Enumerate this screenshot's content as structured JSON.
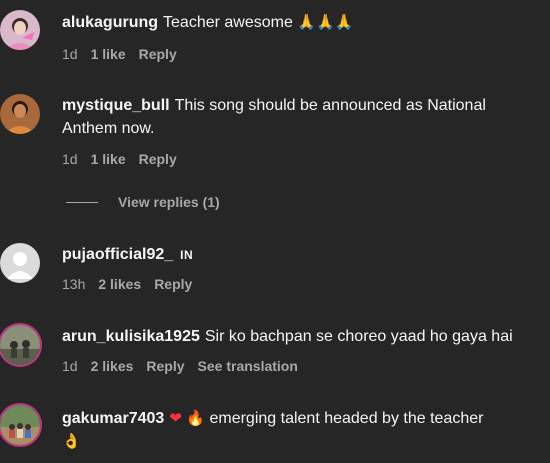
{
  "comments": [
    {
      "username": "alukagurung",
      "text": "Teacher awesome",
      "emoji_icons": [
        "folded-hands-icon",
        "folded-hands-icon",
        "folded-hands-icon"
      ],
      "time": "1d",
      "likes": "1 like",
      "reply": "Reply"
    },
    {
      "username": "mystique_bull",
      "text": "This song should be announced as National Anthem now.",
      "time": "1d",
      "likes": "1 like",
      "reply": "Reply",
      "view_replies": "View replies (1)"
    },
    {
      "username": "pujaofficial92_",
      "badge": "IN",
      "text": "",
      "time": "13h",
      "likes": "2 likes",
      "reply": "Reply"
    },
    {
      "username": "arun_kulisika1925",
      "text": "Sir ko bachpan se choreo yaad ho gaya hai",
      "time": "1d",
      "likes": "2 likes",
      "reply": "Reply",
      "translation": "See translation"
    },
    {
      "username": "gakumar7403",
      "text": "emerging talent headed by the teacher",
      "emoji_icons": [
        "red-heart-icon",
        "fire-icon",
        "ok-hand-icon"
      ]
    }
  ],
  "colors": {
    "background": "#262626",
    "primary_text": "#f5f5f5",
    "secondary_text": "#a8a8a8",
    "story_ring": "#c13584"
  }
}
